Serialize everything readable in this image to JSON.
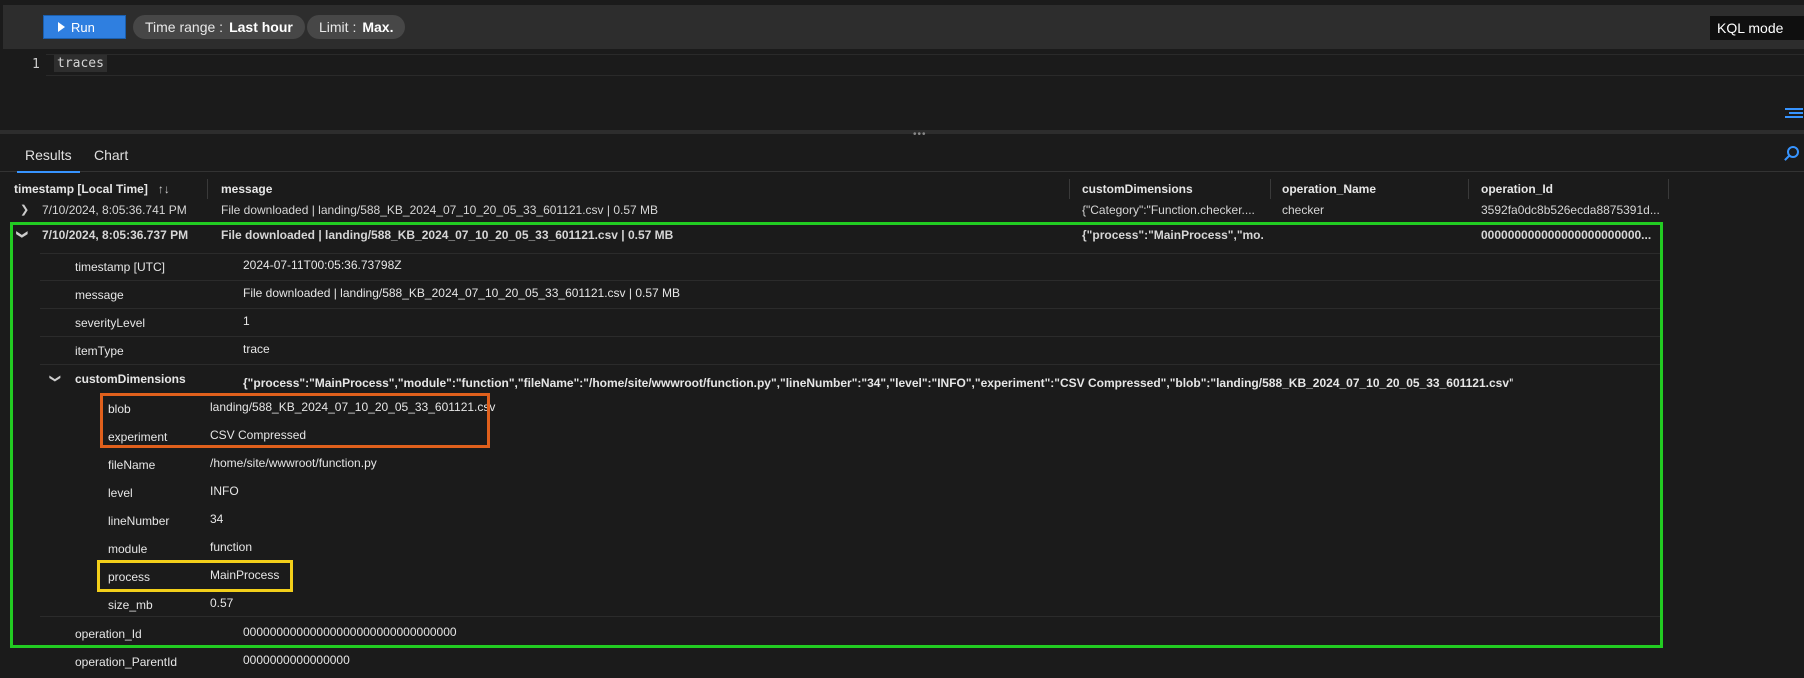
{
  "toolbar": {
    "run_label": "Run",
    "time_range_label": "Time range :",
    "time_range_value": "Last hour",
    "limit_label": "Limit :",
    "limit_value": "Max.",
    "mode": "KQL mode"
  },
  "editor": {
    "line_number": "1",
    "query": "traces"
  },
  "tabs": {
    "results": "Results",
    "chart": "Chart"
  },
  "columns": {
    "timestamp": "timestamp [Local Time]",
    "message": "message",
    "customDimensions": "customDimensions",
    "operation_Name": "operation_Name",
    "operation_Id": "operation_Id"
  },
  "rows": [
    {
      "timestamp": "7/10/2024, 8:05:36.741 PM",
      "message": "File downloaded | landing/588_KB_2024_07_10_20_05_33_601121.csv | 0.57 MB",
      "customDimensions": "{\"Category\":\"Function.checker....",
      "operation_Name": "checker",
      "operation_Id": "3592fa0dc8b526ecda8875391d..."
    },
    {
      "timestamp": "7/10/2024, 8:05:36.737 PM",
      "message": "File downloaded | landing/588_KB_2024_07_10_20_05_33_601121.csv | 0.57 MB",
      "customDimensions": "{\"process\":\"MainProcess\",\"mo...",
      "operation_Name": "",
      "operation_Id": "000000000000000000000000..."
    }
  ],
  "details": {
    "timestamp_utc_label": "timestamp [UTC]",
    "timestamp_utc": "2024-07-11T00:05:36.73798Z",
    "message_label": "message",
    "message": "File downloaded | landing/588_KB_2024_07_10_20_05_33_601121.csv | 0.57 MB",
    "severity_label": "severityLevel",
    "severity": "1",
    "itemtype_label": "itemType",
    "itemtype": "trace",
    "cd_label": "customDimensions",
    "cd_value": "{\"process\":\"MainProcess\",\"module\":\"function\",\"fileName\":\"/home/site/wwwroot/function.py\",\"lineNumber\":\"34\",\"level\":\"INFO\",\"experiment\":\"CSV Compressed\",\"blob\":\"landing/588_KB_2024_07_10_20_05_33_601121.csv\",\"size_mb\":...",
    "cd": {
      "blob_label": "blob",
      "blob": "landing/588_KB_2024_07_10_20_05_33_601121.csv",
      "experiment_label": "experiment",
      "experiment": "CSV Compressed",
      "filename_label": "fileName",
      "filename": "/home/site/wwwroot/function.py",
      "level_label": "level",
      "level": "INFO",
      "linenumber_label": "lineNumber",
      "linenumber": "34",
      "module_label": "module",
      "module": "function",
      "process_label": "process",
      "process": "MainProcess",
      "size_label": "size_mb",
      "size": "0.57"
    },
    "opid_label": "operation_Id",
    "opid": "00000000000000000000000000000000",
    "opparent_label": "operation_ParentId",
    "opparent": "0000000000000000"
  },
  "colors": {
    "run_button": "#2f7fe0",
    "green_highlight": "#22cc22",
    "orange_highlight": "#e0601c",
    "yellow_highlight": "#f2cf1a",
    "accent": "#3794ff"
  }
}
